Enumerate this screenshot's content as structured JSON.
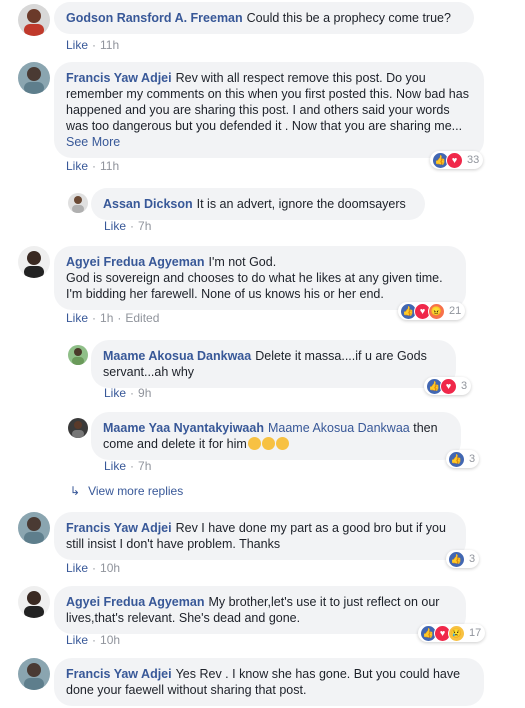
{
  "comments": [
    {
      "author": "Godson Ransford A. Freeman",
      "text": "Could this be a prophecy come true?",
      "like": "Like",
      "time": "11h"
    },
    {
      "author": "Francis Yaw Adjei",
      "text": "Rev with all respect remove this post. Do you remember my comments on this when you first posted this. Now bad has happened and you are sharing this post. I and others said your words was too dangerous but you defended it . Now that you are sharing me...",
      "see_more": "See More",
      "like": "Like",
      "time": "11h",
      "reactions": "33"
    },
    {
      "author": "Assan Dickson",
      "text": "It is an advert, ignore the doomsayers",
      "like": "Like",
      "time": "7h"
    },
    {
      "author": "Agyei Fredua Agyeman",
      "line1": "I'm not God.",
      "line2": "God is sovereign and chooses to do what he likes at any given time. I'm bidding her farewell. None of us knows his or her end.",
      "like": "Like",
      "time": "1h",
      "edited": "Edited",
      "reactions": "21"
    },
    {
      "author": "Maame Akosua Dankwaa",
      "text": "Delete it massa....if u are Gods servant...ah why",
      "like": "Like",
      "time": "9h",
      "reactions": "3"
    },
    {
      "author": "Maame Yaa Nyantakyiwaah",
      "tag": "Maame Akosua Dankwaa",
      "text": "then come and delete it for him",
      "like": "Like",
      "time": "7h",
      "reactions": "3"
    },
    {
      "author": "Francis Yaw Adjei",
      "text": "Rev I have done my part as a good bro but if you still insist I don't have problem. Thanks",
      "like": "Like",
      "time": "10h",
      "reactions": "3"
    },
    {
      "author": "Agyei Fredua Agyeman",
      "text": "My brother,let's use it to just reflect on our lives,that's relevant. She's dead and gone.",
      "like": "Like",
      "time": "10h",
      "reactions": "17"
    },
    {
      "author": "Francis Yaw Adjei",
      "text": "Yes Rev . I know she has gone. But you could have done your faewell without sharing that post."
    }
  ],
  "view_more_replies": "View more replies",
  "colors": {
    "link": "#385898",
    "bubble": "#f2f3f5",
    "meta": "#90949c"
  }
}
